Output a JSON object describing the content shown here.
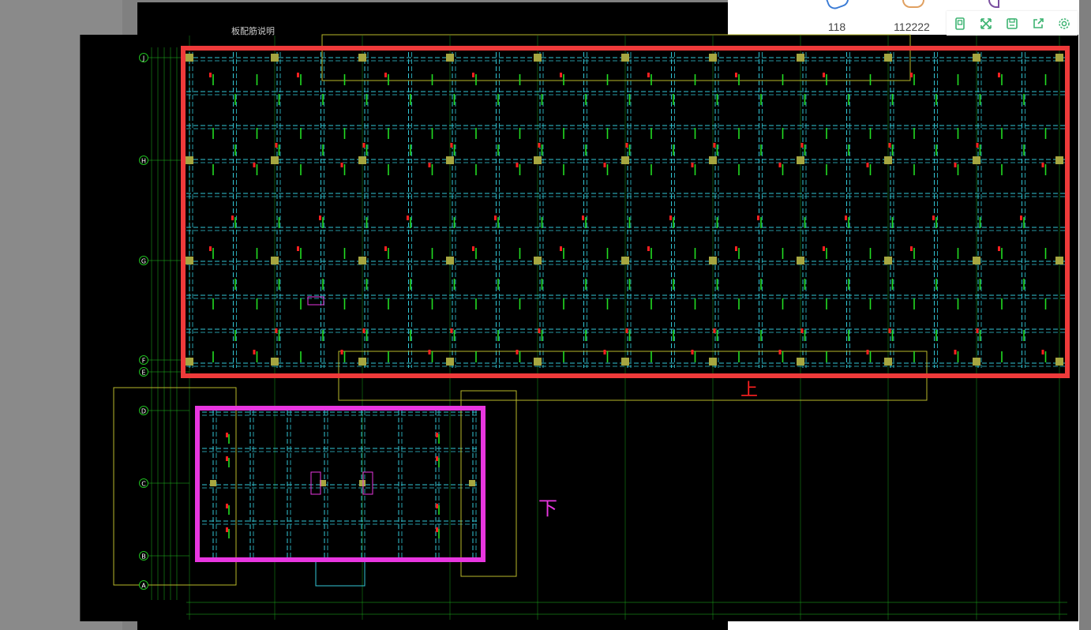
{
  "stats": [
    {
      "icon": "pen-icon",
      "value": "118"
    },
    {
      "icon": "comment-icon",
      "value": "112222"
    },
    {
      "icon": "add-icon",
      "value": ""
    }
  ],
  "toolbar": [
    {
      "name": "fit-page-button",
      "icon": "page-icon"
    },
    {
      "name": "fullscreen-button",
      "icon": "expand-icon"
    },
    {
      "name": "save-button",
      "icon": "save-icon"
    },
    {
      "name": "share-button",
      "icon": "share-icon"
    },
    {
      "name": "settings-button",
      "icon": "gear-icon"
    }
  ],
  "drawing": {
    "title": "板配筋说明",
    "grid_rows": [
      "J",
      "H",
      "G",
      "F",
      "E",
      "D",
      "C",
      "B",
      "A"
    ],
    "annotations": {
      "upper": "上",
      "lower": "下"
    },
    "colors": {
      "background": "#000000",
      "beam": "#33c8d8",
      "grid": "#1fbf1f",
      "column": "#a6a640",
      "rebar_mark": "#22dd22",
      "rebar_red": "#ff2020",
      "outline": "#b9b92a",
      "upper_frame": "#ef3a3a",
      "lower_frame": "#e836e0",
      "accent": "#3cb371"
    }
  }
}
